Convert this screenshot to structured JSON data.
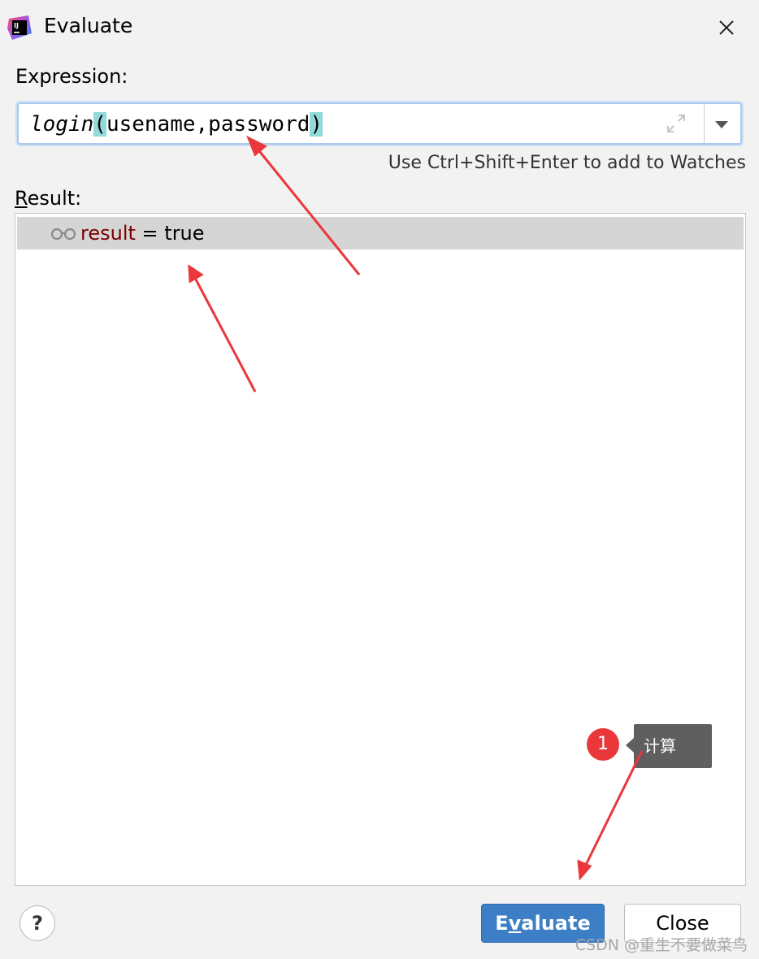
{
  "window": {
    "title": "Evaluate",
    "app_icon_text": "IJ"
  },
  "expression": {
    "label": "Expression:",
    "function_name": "login",
    "open_paren": "(",
    "arguments": "usename,password",
    "close_paren": ")",
    "hint": "Use Ctrl+Shift+Enter to add to Watches"
  },
  "result": {
    "label_first_letter": "R",
    "label_rest": "esult:",
    "variable": "result",
    "equals": " = ",
    "value": "true"
  },
  "annotation": {
    "step_number": "1",
    "tooltip_text": "计算",
    "arrow_color": "#e9373b"
  },
  "buttons": {
    "help": "?",
    "evaluate_before": "E",
    "evaluate_mnemonic": "v",
    "evaluate_after": "aluate",
    "close": "Close"
  },
  "watermark": "CSDN @重生不要做菜鸟",
  "colors": {
    "accent": "#3d7fc6",
    "paren_highlight": "#93d9d9",
    "variable": "#7a0000",
    "selected_row": "#d5d5d5"
  }
}
